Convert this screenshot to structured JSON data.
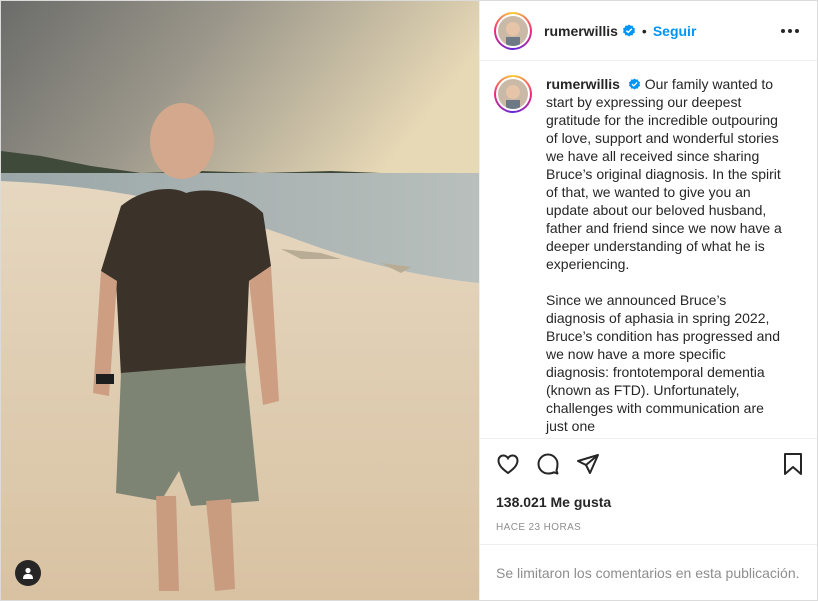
{
  "post": {
    "username": "rumerwillis",
    "follow_label": "Seguir",
    "caption_paragraphs": [
      "Our family wanted to start by expressing our deepest gratitude for the incredible outpouring of love, support and wonderful stories we have all received since sharing Bruce’s original diagnosis. In the spirit of that, we wanted to give you an update about our beloved husband, father and friend since we now have a deeper understanding of what he is experiencing.",
      "Since we announced Bruce’s diagnosis of aphasia in spring 2022, Bruce’s condition has progressed and we now have a more specific diagnosis: frontotemporal dementia (known as FTD). Unfortunately, challenges with communication are just one"
    ],
    "likes": "138.021 Me gusta",
    "time": "HACE 23 HORAS",
    "comments_notice": "Se limitaron los comentarios en esta publicación."
  },
  "icons": {
    "verified": "verified-badge-icon",
    "like": "heart-icon",
    "comment": "comment-icon",
    "share": "share-icon",
    "save": "bookmark-icon",
    "more": "more-options-icon",
    "user_tag": "user-tag-icon"
  },
  "colors": {
    "accent": "#0095f6",
    "text": "#262626",
    "muted": "#8e8e8e"
  }
}
